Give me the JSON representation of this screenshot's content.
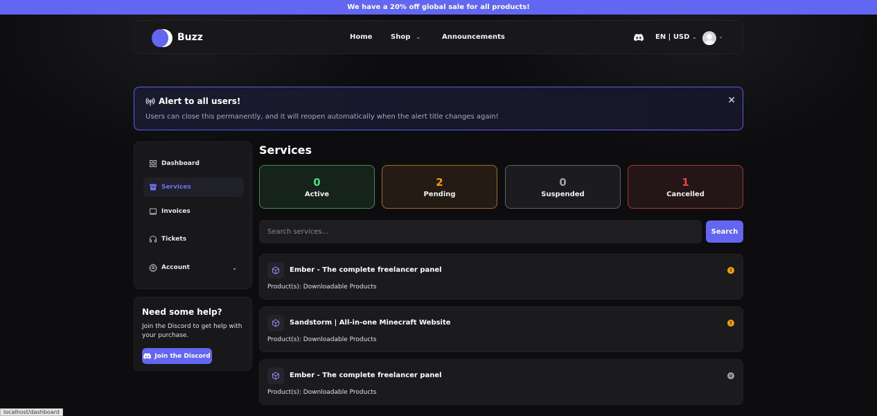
{
  "sale_banner": "We have a 20% off global sale for all products!",
  "brand": {
    "name": "Buzz",
    "accent": "#6366f1"
  },
  "nav": {
    "home": "Home",
    "shop": "Shop",
    "announcements": "Announcements",
    "lang_currency": "EN | USD"
  },
  "alert": {
    "title": "Alert to all users!",
    "text": "Users can close this permanently, and it will reopen automatically when the alert title changes again!",
    "close": "✕"
  },
  "sidebar": {
    "items": [
      {
        "label": "Dashboard",
        "icon": "grid-icon"
      },
      {
        "label": "Services",
        "icon": "box-icon",
        "active": true
      },
      {
        "label": "Invoices",
        "icon": "invoice-icon"
      },
      {
        "label": "Tickets",
        "icon": "headset-icon"
      },
      {
        "label": "Account",
        "icon": "gear-icon"
      }
    ]
  },
  "help": {
    "title": "Need some help?",
    "text": "Join the Discord to get help with your purchase.",
    "button": "Join the Discord"
  },
  "main": {
    "title": "Services",
    "stats": {
      "active": {
        "count": "0",
        "label": "Active",
        "color": "#4ade80"
      },
      "pending": {
        "count": "2",
        "label": "Pending",
        "color": "#f59e0b"
      },
      "suspended": {
        "count": "0",
        "label": "Suspended",
        "color": "#a1a1aa"
      },
      "cancelled": {
        "count": "1",
        "label": "Cancelled",
        "color": "#ef4444"
      }
    },
    "search": {
      "placeholder": "Search services...",
      "button": "Search"
    },
    "services": [
      {
        "name": "Ember - The complete freelancer panel",
        "products": "Product(s): Downloadable Products",
        "status": "pending"
      },
      {
        "name": "Sandstorm | All-in-one Minecraft Website",
        "products": "Product(s): Downloadable Products",
        "status": "pending"
      },
      {
        "name": "Ember - The complete freelancer panel",
        "products": "Product(s): Downloadable Products",
        "status": "suspended"
      }
    ]
  },
  "status_url": "localhost/dashboard"
}
